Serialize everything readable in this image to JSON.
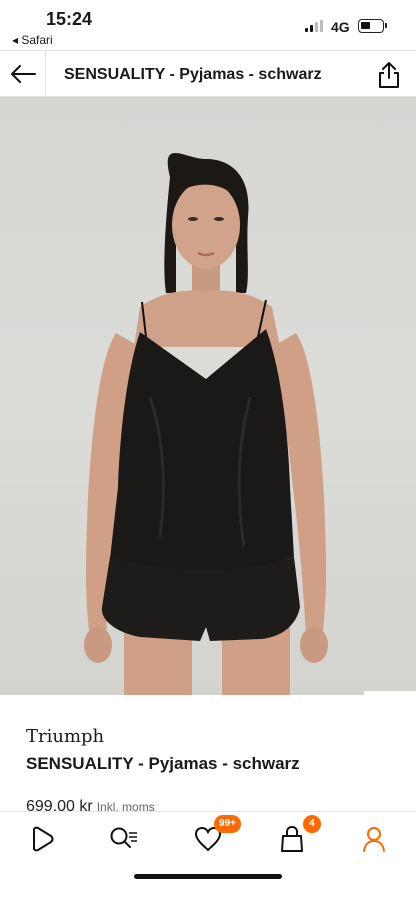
{
  "status_bar": {
    "time": "15:24",
    "back_app": "◂ Safari",
    "network": "4G"
  },
  "navbar": {
    "title": "SENSUALITY - Pyjamas - schwarz"
  },
  "gallery": {
    "progress_fraction": 0.14
  },
  "product": {
    "brand": "Triumph",
    "name": "SENSUALITY - Pyjamas - schwarz",
    "price": "699,00 kr",
    "price_note": "Inkl. moms"
  },
  "tabbar": {
    "wishlist_badge": "99+",
    "bag_badge": "4",
    "accent_color": "#ff6900"
  },
  "icons": [
    "back-arrow-icon",
    "share-icon",
    "try-on-icon",
    "heart-icon",
    "shopping-bag-icon",
    "home-icon",
    "search-icon",
    "wishlist-icon",
    "bag-icon",
    "profile-icon"
  ]
}
